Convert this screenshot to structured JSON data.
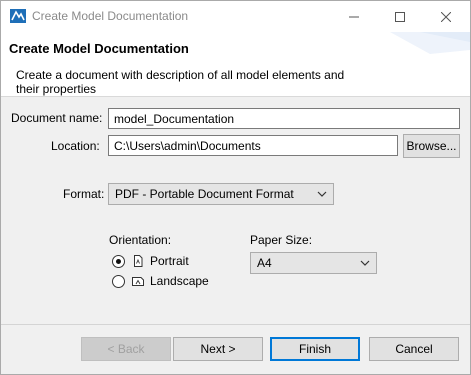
{
  "window": {
    "title": "Create Model Documentation",
    "controls": {
      "minimize": "minimize-icon",
      "maximize": "maximize-icon",
      "close": "close-icon"
    }
  },
  "banner": {
    "title": "Create Model Documentation",
    "description": "Create a document with description of all model elements and their properties"
  },
  "form": {
    "document_name_label": "Document name:",
    "document_name_value": "model_Documentation",
    "location_label": "Location:",
    "location_value": "C:\\Users\\admin\\Documents",
    "browse_label": "Browse...",
    "format_label": "Format:",
    "format_value": "PDF - Portable Document Format",
    "orientation_label": "Orientation:",
    "orientation_options": [
      {
        "label": "Portrait",
        "selected": true,
        "icon": "portrait-page-icon"
      },
      {
        "label": "Landscape",
        "selected": false,
        "icon": "landscape-page-icon"
      }
    ],
    "paper_size_label": "Paper Size:",
    "paper_size_value": "A4"
  },
  "buttons": {
    "back": "< Back",
    "next": "Next >",
    "finish": "Finish",
    "cancel": "Cancel"
  },
  "colors": {
    "focus_border": "#0078d7",
    "dialog_bg": "#f0f0f0"
  }
}
